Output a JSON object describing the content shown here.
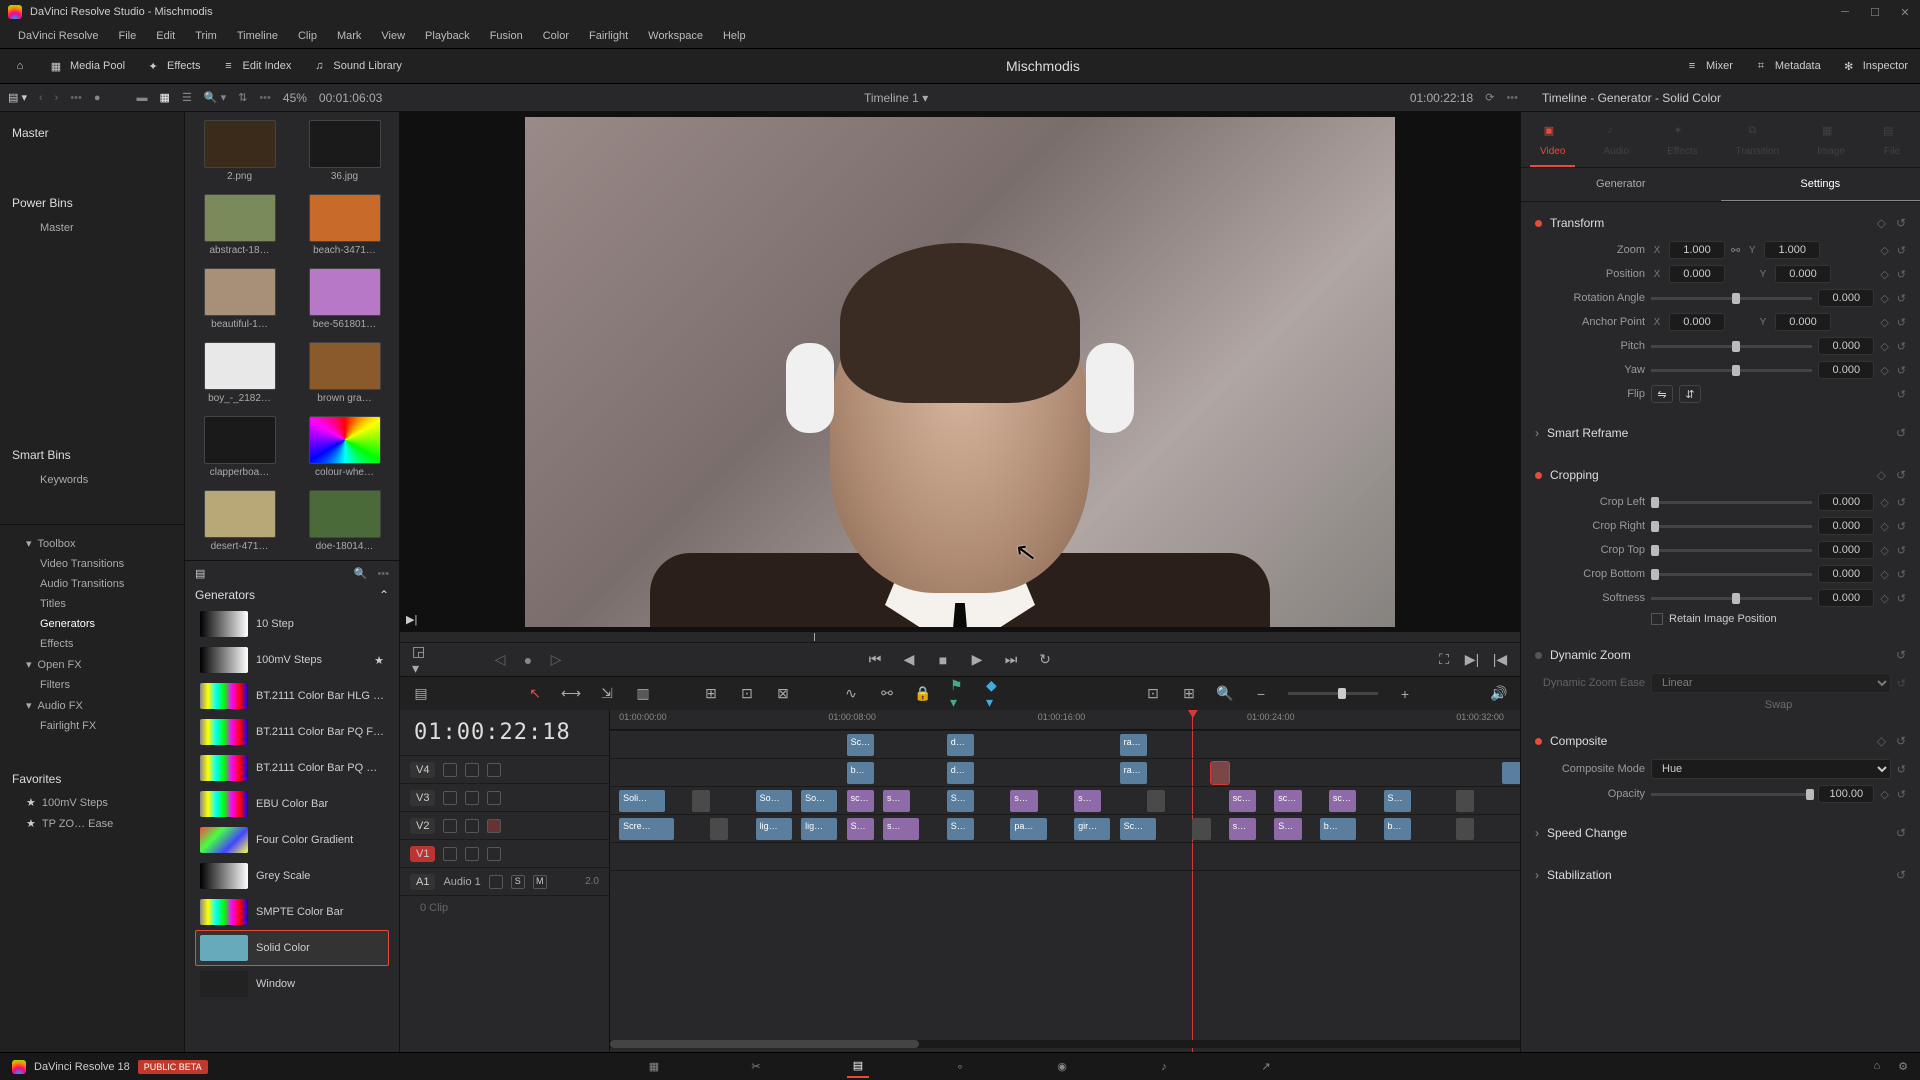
{
  "window": {
    "title": "DaVinci Resolve Studio - Mischmodis"
  },
  "menu": [
    "DaVinci Resolve",
    "File",
    "Edit",
    "Trim",
    "Timeline",
    "Clip",
    "Mark",
    "View",
    "Playback",
    "Fusion",
    "Color",
    "Fairlight",
    "Workspace",
    "Help"
  ],
  "topbar": {
    "media_pool": "Media Pool",
    "effects": "Effects",
    "edit_index": "Edit Index",
    "sound_library": "Sound Library",
    "mixer": "Mixer",
    "metadata": "Metadata",
    "inspector": "Inspector",
    "project": "Mischmodis"
  },
  "subbar": {
    "zoom_pct": "45%",
    "src_tc": "00:01:06:03",
    "timeline_name": "Timeline 1",
    "record_tc": "01:00:22:18"
  },
  "tree": {
    "master": "Master",
    "power_bins": "Power Bins",
    "power_items": [
      "Master"
    ],
    "smart_bins": "Smart Bins",
    "smart_items": [
      "Keywords"
    ],
    "toolbox": "Toolbox",
    "toolbox_items": [
      "Video Transitions",
      "Audio Transitions",
      "Titles",
      "Generators",
      "Effects"
    ],
    "openfx": "Open FX",
    "openfx_items": [
      "Filters"
    ],
    "audiofx": "Audio FX",
    "audiofx_items": [
      "Fairlight FX"
    ],
    "favorites": "Favorites",
    "favorites_items": [
      "100mV Steps",
      "TP ZO… Ease"
    ]
  },
  "pool_clips": [
    {
      "name": "2.png",
      "bg": "#3b2b1a"
    },
    {
      "name": "36.jpg",
      "bg": "#1a1a1a"
    },
    {
      "name": "abstract-18…",
      "bg": "#7a8a5a"
    },
    {
      "name": "beach-3471…",
      "bg": "#c86a2a"
    },
    {
      "name": "beautiful-1…",
      "bg": "#a89078"
    },
    {
      "name": "bee-561801…",
      "bg": "#b878c8"
    },
    {
      "name": "boy_-_2182…",
      "bg": "#e8e8e8"
    },
    {
      "name": "brown gra…",
      "bg": "#8a5a2a"
    },
    {
      "name": "clapperboa…",
      "bg": "#1a1a1a"
    },
    {
      "name": "colour-whe…",
      "bg": "conic"
    },
    {
      "name": "desert-471…",
      "bg": "#b8a878"
    },
    {
      "name": "doe-18014…",
      "bg": "#4a6a3a"
    }
  ],
  "fx_header": "Generators",
  "generators": [
    {
      "name": "10 Step",
      "fav": false
    },
    {
      "name": "100mV Steps",
      "fav": true
    },
    {
      "name": "BT.2111 Color Bar HLG …",
      "fav": false
    },
    {
      "name": "BT.2111 Color Bar PQ F…",
      "fav": false
    },
    {
      "name": "BT.2111 Color Bar PQ …",
      "fav": false
    },
    {
      "name": "EBU Color Bar",
      "fav": false
    },
    {
      "name": "Four Color Gradient",
      "fav": false
    },
    {
      "name": "Grey Scale",
      "fav": false
    },
    {
      "name": "SMPTE Color Bar",
      "fav": false
    },
    {
      "name": "Solid Color",
      "fav": false,
      "selected": true
    },
    {
      "name": "Window",
      "fav": false
    }
  ],
  "timeline": {
    "tc_display": "01:00:22:18",
    "ruler": [
      "01:00:00:00",
      "01:00:08:00",
      "01:00:16:00",
      "01:00:24:00",
      "01:00:32:00"
    ],
    "tracks": [
      {
        "id": "V4",
        "locked": false
      },
      {
        "id": "V3",
        "locked": false
      },
      {
        "id": "V2",
        "locked": false,
        "disabled": true
      },
      {
        "id": "V1",
        "locked": false,
        "active": true
      },
      {
        "id": "A1",
        "label": "Audio 1",
        "ch": "2.0",
        "audio": true,
        "sub": "0 Clip"
      }
    ],
    "clips_v4": [
      {
        "l": 26,
        "w": 3,
        "t": "Sc…"
      },
      {
        "l": 37,
        "w": 3,
        "t": "d…"
      },
      {
        "l": 56,
        "w": 3,
        "t": "ra…"
      }
    ],
    "clips_v3": [
      {
        "l": 26,
        "w": 3,
        "t": "b…"
      },
      {
        "l": 37,
        "w": 3,
        "t": "d…"
      },
      {
        "l": 56,
        "w": 3,
        "t": "ra…"
      },
      {
        "l": 66,
        "w": 2,
        "t": "",
        "sel": true
      },
      {
        "l": 98,
        "w": 3,
        "t": ""
      }
    ],
    "clips_v2": [
      {
        "l": 1,
        "w": 5,
        "t": "Soli…"
      },
      {
        "l": 9,
        "w": 2,
        "t": "",
        "c": "gray"
      },
      {
        "l": 16,
        "w": 4,
        "t": "So…"
      },
      {
        "l": 21,
        "w": 4,
        "t": "So…"
      },
      {
        "l": 26,
        "w": 3,
        "t": "sc…",
        "c": "purple"
      },
      {
        "l": 30,
        "w": 3,
        "t": "s…",
        "c": "purple"
      },
      {
        "l": 37,
        "w": 3,
        "t": "S…"
      },
      {
        "l": 44,
        "w": 3,
        "t": "s…",
        "c": "purple"
      },
      {
        "l": 51,
        "w": 3,
        "t": "s…",
        "c": "purple"
      },
      {
        "l": 59,
        "w": 2,
        "t": "",
        "c": "gray"
      },
      {
        "l": 68,
        "w": 3,
        "t": "sc…",
        "c": "purple"
      },
      {
        "l": 73,
        "w": 3,
        "t": "sc…",
        "c": "purple"
      },
      {
        "l": 79,
        "w": 3,
        "t": "sc…",
        "c": "purple"
      },
      {
        "l": 85,
        "w": 3,
        "t": "S…"
      },
      {
        "l": 93,
        "w": 2,
        "t": "",
        "c": "gray"
      }
    ],
    "clips_v1": [
      {
        "l": 1,
        "w": 6,
        "t": "Scre…"
      },
      {
        "l": 11,
        "w": 2,
        "t": "",
        "c": "gray"
      },
      {
        "l": 16,
        "w": 4,
        "t": "lig…"
      },
      {
        "l": 21,
        "w": 4,
        "t": "lig…"
      },
      {
        "l": 26,
        "w": 3,
        "t": "S…",
        "c": "purple"
      },
      {
        "l": 30,
        "w": 4,
        "t": "s…",
        "c": "purple"
      },
      {
        "l": 37,
        "w": 3,
        "t": "S…"
      },
      {
        "l": 44,
        "w": 4,
        "t": "pa…"
      },
      {
        "l": 51,
        "w": 4,
        "t": "gir…"
      },
      {
        "l": 56,
        "w": 4,
        "t": "Sc…"
      },
      {
        "l": 64,
        "w": 2,
        "t": "",
        "c": "gray"
      },
      {
        "l": 68,
        "w": 3,
        "t": "s…",
        "c": "purple"
      },
      {
        "l": 73,
        "w": 3,
        "t": "S…",
        "c": "purple"
      },
      {
        "l": 78,
        "w": 4,
        "t": "b…"
      },
      {
        "l": 85,
        "w": 3,
        "t": "b…"
      },
      {
        "l": 93,
        "w": 2,
        "t": "",
        "c": "gray"
      }
    ]
  },
  "inspector": {
    "title": "Timeline - Generator - Solid Color",
    "tabs": [
      "Video",
      "Audio",
      "Effects",
      "Transition",
      "Image",
      "File"
    ],
    "subtabs": [
      "Generator",
      "Settings"
    ],
    "transform": {
      "title": "Transform",
      "zoom": "Zoom",
      "zoom_x": "1.000",
      "zoom_y": "1.000",
      "position": "Position",
      "pos_x": "0.000",
      "pos_y": "0.000",
      "rotation": "Rotation Angle",
      "rot_v": "0.000",
      "anchor": "Anchor Point",
      "anc_x": "0.000",
      "anc_y": "0.000",
      "pitch": "Pitch",
      "pitch_v": "0.000",
      "yaw": "Yaw",
      "yaw_v": "0.000",
      "flip": "Flip"
    },
    "smart_reframe": "Smart Reframe",
    "cropping": {
      "title": "Cropping",
      "left": "Crop Left",
      "left_v": "0.000",
      "right": "Crop Right",
      "right_v": "0.000",
      "top": "Crop Top",
      "top_v": "0.000",
      "bottom": "Crop Bottom",
      "bottom_v": "0.000",
      "soft": "Softness",
      "soft_v": "0.000",
      "retain": "Retain Image Position"
    },
    "dynamic_zoom": {
      "title": "Dynamic Zoom",
      "ease": "Dynamic Zoom Ease",
      "ease_v": "Linear",
      "swap": "Swap"
    },
    "composite": {
      "title": "Composite",
      "mode": "Composite Mode",
      "mode_v": "Hue",
      "opacity": "Opacity",
      "opacity_v": "100.00"
    },
    "speed_change": "Speed Change",
    "stabilization": "Stabilization"
  },
  "pagebar": {
    "app": "DaVinci Resolve 18",
    "badge": "PUBLIC BETA"
  }
}
